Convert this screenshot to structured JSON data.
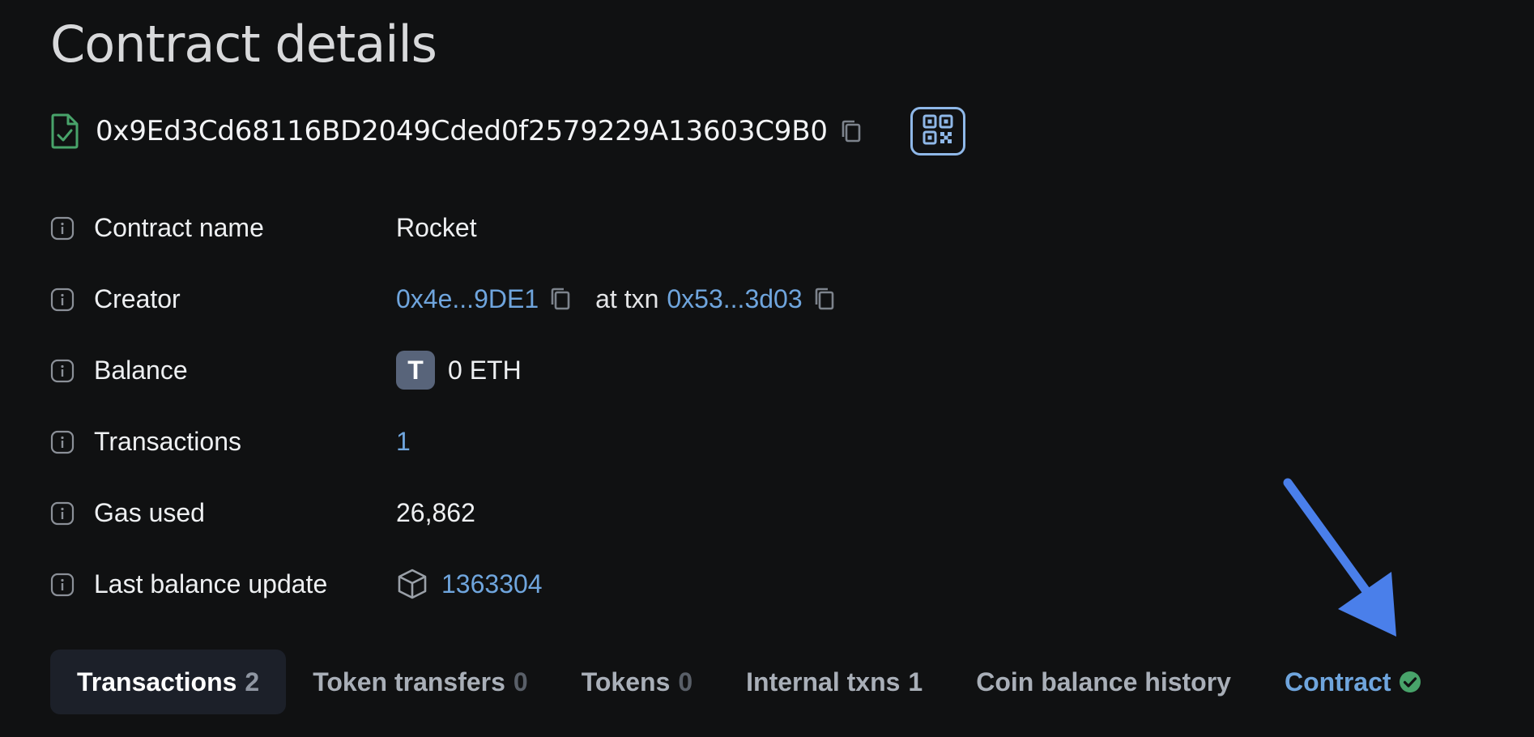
{
  "page_title": "Contract details",
  "address": {
    "value": "0x9Ed3Cd68116BD2049Cded0f2579229A13603C9B0",
    "icon": "contract-file-icon",
    "copy_icon": "copy-icon",
    "qr_icon": "qr-code-icon"
  },
  "details": {
    "contract_name": {
      "label": "Contract name",
      "value": "Rocket"
    },
    "creator": {
      "label": "Creator",
      "address": "0x4e...9DE1",
      "at_txn_text": "at txn",
      "txn": "0x53...3d03"
    },
    "balance": {
      "label": "Balance",
      "token_letter": "T",
      "value": "0 ETH"
    },
    "transactions": {
      "label": "Transactions",
      "value": "1"
    },
    "gas_used": {
      "label": "Gas used",
      "value": "26,862"
    },
    "last_balance_update": {
      "label": "Last balance update",
      "block": "1363304",
      "icon": "block-cube-icon"
    }
  },
  "tabs": [
    {
      "label": "Transactions",
      "count": "2",
      "active": true
    },
    {
      "label": "Token transfers",
      "count": "0",
      "active": false
    },
    {
      "label": "Tokens",
      "count": "0",
      "active": false
    },
    {
      "label": "Internal txns",
      "count": "1",
      "active": false
    },
    {
      "label": "Coin balance history",
      "count": "",
      "active": false
    },
    {
      "label": "Contract",
      "count": "",
      "active": false,
      "verified": true
    }
  ],
  "colors": {
    "background": "#101112",
    "link": "#6fa5dd",
    "verified_green": "#48a36a",
    "annotation_arrow": "#4a7fea"
  }
}
